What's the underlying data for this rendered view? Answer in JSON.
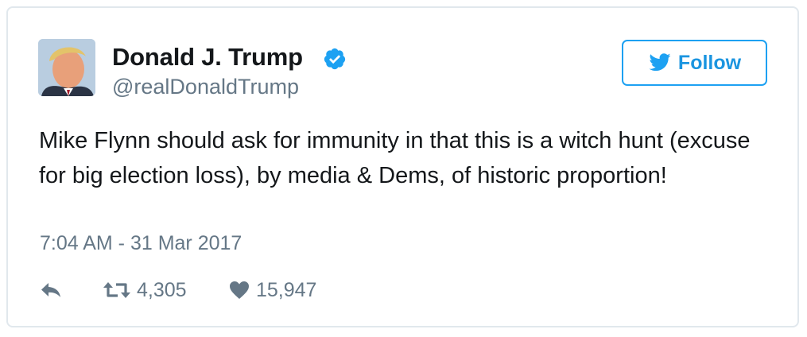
{
  "user": {
    "name": "Donald J. Trump",
    "handle": "@realDonaldTrump",
    "verified": true,
    "avatar_icon": "profile-photo"
  },
  "follow_button": {
    "label": "Follow",
    "icon": "twitter-bird-icon"
  },
  "tweet": {
    "text": "Mike Flynn should ask for immunity in that this is a witch hunt (excuse for big election loss), by media & Dems, of historic proportion!",
    "timestamp": "7:04 AM - 31 Mar 2017"
  },
  "actions": {
    "reply_icon": "reply-icon",
    "retweet_icon": "retweet-icon",
    "retweets": "4,305",
    "like_icon": "heart-icon",
    "likes": "15,947"
  },
  "colors": {
    "accent": "#1da1f2",
    "text": "#14171a",
    "secondary": "#657786",
    "border": "#e1e8ed"
  }
}
